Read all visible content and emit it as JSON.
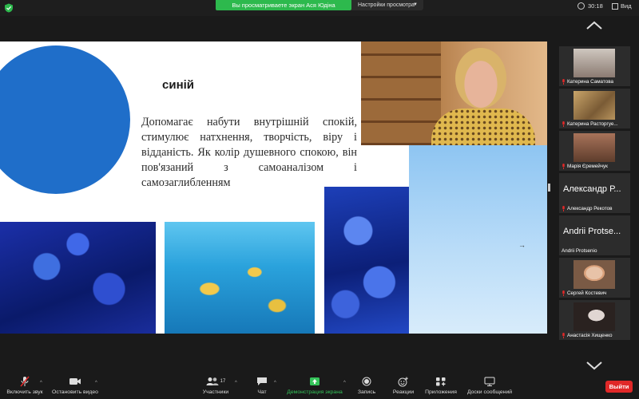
{
  "topbar": {
    "share_banner": "Вы просматриваете экран Ася Юдіна",
    "view_settings": "Настройки просмотра",
    "timer": "30:18",
    "view": "Вид"
  },
  "slide": {
    "title": "синій",
    "body": "Допомагає набути внутрішній спокій, стимулює натхнення, творчість, віру і відданість. Як колір душевного спокою, він пов'язаний з самоаналізом і самозаглибленням",
    "circle_color": "#1f6ec9"
  },
  "participants": [
    {
      "name": "Катерина Саматова",
      "muted": true,
      "video": true
    },
    {
      "name": "Катерина Расторгуе...",
      "muted": true,
      "video": true
    },
    {
      "name": "Марія Єремейчук",
      "muted": true,
      "video": true
    },
    {
      "display": "Александр Р...",
      "name": "Александр Рекотов",
      "muted": true,
      "video": false
    },
    {
      "display": "Andrii Protse...",
      "name": "Andrii Protsenio",
      "muted": false,
      "video": false
    },
    {
      "name": "Сергей Костевич",
      "muted": true,
      "video": true
    },
    {
      "name": "Анастасія Хищенко",
      "muted": true,
      "video": true
    }
  ],
  "toolbar": {
    "unmute": "Включить звук",
    "stop_video": "Остановить видео",
    "participants": "Участники",
    "participants_count": "17",
    "chat": "Чат",
    "share": "Демонстрация экрана",
    "record": "Запись",
    "reactions": "Реакции",
    "apps": "Приложения",
    "whiteboard": "Доски сообщений",
    "leave": "Выйти"
  },
  "colors": {
    "share_green": "#2db94d",
    "leave_red": "#e02828",
    "mute_red": "#e02828"
  }
}
